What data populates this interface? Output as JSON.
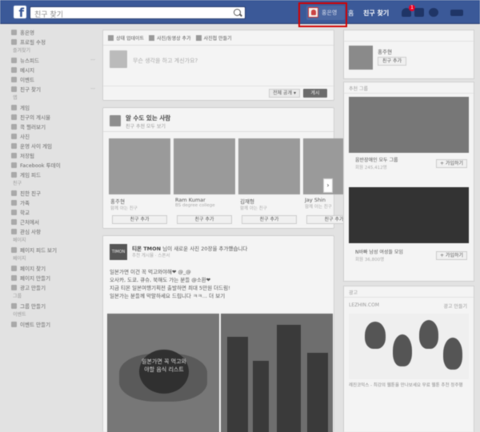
{
  "topbar": {
    "logo": "f",
    "search_placeholder": "친구 찾기",
    "profile_name": "홍은영",
    "home": "홈",
    "find_friends": "친구 찾기",
    "friend_request_count": "1"
  },
  "sidebar": {
    "items": [
      {
        "label": "홍은영",
        "count": ""
      },
      {
        "label": "프로필 수정",
        "count": ""
      },
      {
        "head": "즐겨찾기"
      },
      {
        "label": "뉴스피드",
        "count": "···"
      },
      {
        "label": "메시지",
        "count": ""
      },
      {
        "label": "이벤트",
        "count": ""
      },
      {
        "label": "친구 찾기",
        "count": "···"
      },
      {
        "head": "앱"
      },
      {
        "label": "게임",
        "count": ""
      },
      {
        "label": "친구의 게시물",
        "count": ""
      },
      {
        "label": "콕 찔러보기",
        "count": ""
      },
      {
        "label": "사진",
        "count": ""
      },
      {
        "label": "운영 사이 게임",
        "count": ""
      },
      {
        "label": "저장됨",
        "count": ""
      },
      {
        "label": "Facebook 투데이",
        "count": ""
      },
      {
        "label": "게임 피드",
        "count": ""
      },
      {
        "head": "친구"
      },
      {
        "label": "친한 친구",
        "count": ""
      },
      {
        "label": "가족",
        "count": ""
      },
      {
        "label": "학교",
        "count": ""
      },
      {
        "label": "근처에서",
        "count": ""
      },
      {
        "label": "관심 사항",
        "count": ""
      },
      {
        "head": "페이지"
      },
      {
        "label": "페이지 피드 보기",
        "count": ""
      },
      {
        "head": "페이지"
      },
      {
        "label": "페이지 찾기",
        "count": ""
      },
      {
        "label": "페이지 만들기",
        "count": ""
      },
      {
        "label": "광고 만들기",
        "count": ""
      },
      {
        "head": "그룹"
      },
      {
        "label": "그룹 만들기",
        "count": ""
      },
      {
        "head": "이벤트"
      },
      {
        "label": "이벤트 만들기",
        "count": ""
      }
    ]
  },
  "composer": {
    "tabs": [
      "상태 업데이트",
      "사진/동영상 추가",
      "사진첩 만들기"
    ],
    "placeholder": "무슨 생각을 하고 계신가요?",
    "privacy": "전체 공개 ▾",
    "post_button": "게시"
  },
  "pymk": {
    "title": "알 수도 있는 사람",
    "subtitle": "친구 추천 모두 보기",
    "people": [
      {
        "name": "홍주현",
        "meta": "함께 아는 친구",
        "button": "친구 추가"
      },
      {
        "name": "Ram Kumar",
        "meta": "BS degree college",
        "button": "친구 추가"
      },
      {
        "name": "김재형",
        "meta": "함께 아는 친구",
        "button": "친구 추가"
      },
      {
        "name": "Jay Shin",
        "meta": "함께 아는 친구",
        "button": "친구 추가"
      }
    ]
  },
  "post": {
    "logo": "TIMON",
    "title": "티몬 TMON",
    "title_rest": "님이 새로운 사진 20장을 추가했습니다",
    "meta": "추천 게시물 · 스폰서",
    "text": [
      "일본가면 이건 꼭 먹고와야해❤ @_@",
      "오사카, 도쿄, 큐슈, 북해도 가는 분들 @소환❤",
      "지금 티몬 일본여행기획전 출발하면 최대 5만원 더드림!",
      "일본가는 분들께 막말하세요 드립니다 ㅋㅋ... 더 보기"
    ],
    "img_caption": "일본가면 꼭 먹고와야할 음식 리스트"
  },
  "right": {
    "card1": {
      "name": "홍주현",
      "button": "친구 추가"
    },
    "groups_title": "추천 그룹",
    "groups": [
      {
        "name": "음반장애인 모두 그룹",
        "members": "회원 245,412명",
        "button": "+ 가입하기"
      },
      {
        "name": "N바빠 남성 여성들 모임",
        "members": "회원 36,800명",
        "button": "+ 가입하기"
      }
    ],
    "sponsored_title": "광고",
    "sponsored_create": "광고 만들기",
    "sponsored_sub": "LEZHIN.COM",
    "sponsored_text": "레진코믹스 - 최강의 웹툰을 만나보세요 무료 웹툰 추천 정주행"
  }
}
